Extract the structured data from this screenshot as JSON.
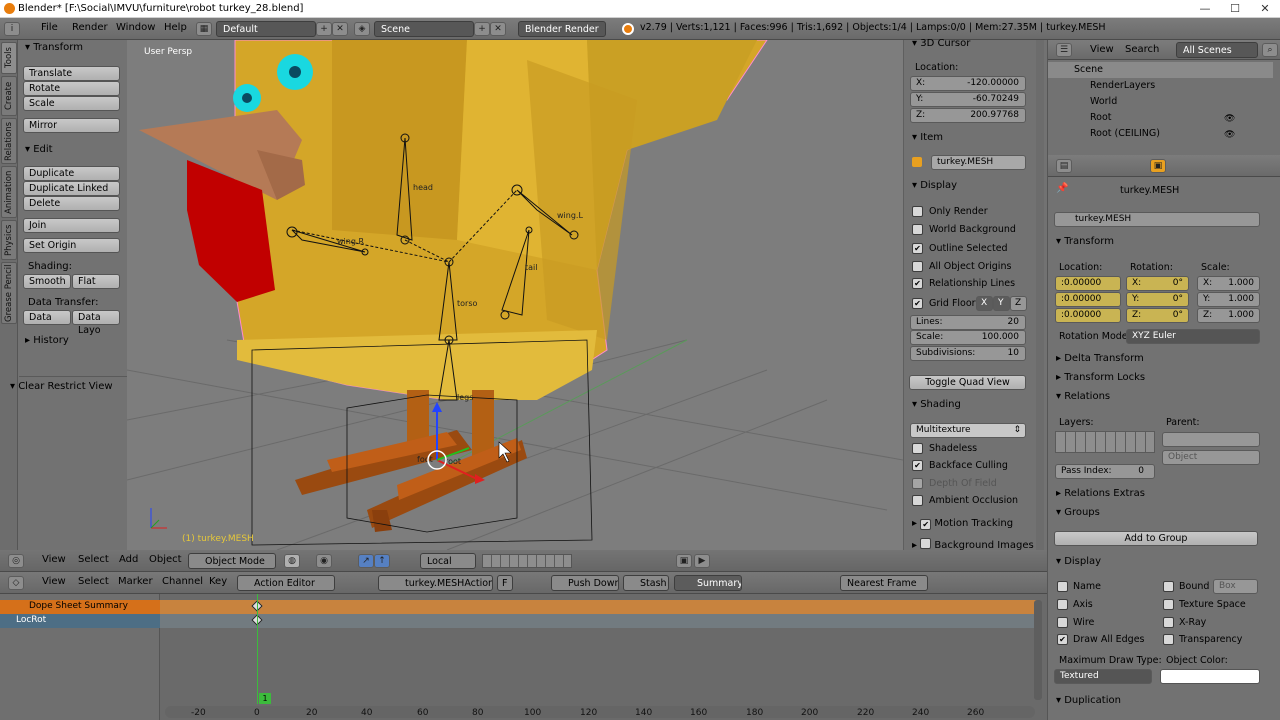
{
  "window": {
    "title": "Blender* [F:\\Social\\IMVU\\furniture\\robot turkey_28.blend]",
    "min": "—",
    "max": "☐",
    "close": "✕"
  },
  "infobar": {
    "menus": [
      "File",
      "Render",
      "Window",
      "Help"
    ],
    "layout": "Default",
    "scene": "Scene",
    "engine": "Blender Render",
    "stats": "v2.79 | Verts:1,121 | Faces:996 | Tris:1,692 | Objects:1/4 | Lamps:0/0 | Mem:27.35M | turkey.MESH"
  },
  "tabs": [
    "Tools",
    "Create",
    "Relations",
    "Animation",
    "Physics",
    "Grease Pencil"
  ],
  "toolshelf": {
    "transform_title": "Transform",
    "translate": "Translate",
    "rotate": "Rotate",
    "scale": "Scale",
    "mirror": "Mirror",
    "edit_title": "Edit",
    "duplicate": "Duplicate",
    "duplicate_linked": "Duplicate Linked",
    "delete": "Delete",
    "join": "Join",
    "set_origin": "Set Origin",
    "shading_label": "Shading:",
    "smooth": "Smooth",
    "flat": "Flat",
    "data_transfer_label": "Data Transfer:",
    "data": "Data",
    "data_layo": "Data Layo",
    "history": "History",
    "clear_restrict": "Clear Restrict View"
  },
  "viewport": {
    "label": "User Persp",
    "object_label": "(1) turkey.MESH",
    "bones": [
      "head",
      "wing.L",
      "wing.R",
      "tail",
      "torso",
      "legs",
      "foot",
      "root"
    ]
  },
  "npanel": {
    "cursor_title": "3D Cursor",
    "location_label": "Location:",
    "x": "X:",
    "x_val": "-120.00000",
    "y": "Y:",
    "y_val": "-60.70249",
    "z": "Z:",
    "z_val": "200.97768",
    "item_title": "Item",
    "item_name": "turkey.MESH",
    "display_title": "Display",
    "only_render": "Only Render",
    "world_bg": "World Background",
    "outline_sel": "Outline Selected",
    "all_origins": "All Object Origins",
    "rel_lines": "Relationship Lines",
    "grid_floor": "Grid Floor",
    "gx": "X",
    "gy": "Y",
    "gz": "Z",
    "lines": "Lines:",
    "lines_val": "20",
    "scale": "Scale:",
    "scale_val": "100.000",
    "subdiv": "Subdivisions:",
    "subdiv_val": "10",
    "toggle_quad": "Toggle Quad View",
    "shading_title": "Shading",
    "multitexture": "Multitexture",
    "shadeless": "Shadeless",
    "backface": "Backface Culling",
    "dof": "Depth Of Field",
    "ao": "Ambient Occlusion",
    "motion_tracking": "Motion Tracking",
    "bg_images": "Background Images"
  },
  "outliner": {
    "view": "View",
    "search": "Search",
    "filter": "All Scenes",
    "items": [
      "Scene",
      "RenderLayers",
      "World",
      "Root",
      "Root (CEILING)"
    ]
  },
  "properties": {
    "breadcrumb": "turkey.MESH",
    "name": "turkey.MESH",
    "transform_title": "Transform",
    "location": "Location:",
    "rotation": "Rotation:",
    "scale": "Scale:",
    "lx": ":0.00000",
    "ly": ":0.00000",
    "lz": ":0.00000",
    "rx": "X:",
    "rx_val": "0°",
    "ry": "Y:",
    "ry_val": "0°",
    "rz": "Z:",
    "rz_val": "0°",
    "sx": "X:",
    "sx_val": "1.000",
    "sy": "Y:",
    "sy_val": "1.000",
    "sz": "Z:",
    "sz_val": "1.000",
    "rot_mode_label": "Rotation Mode:",
    "rot_mode": "XYZ Euler",
    "delta": "Delta Transform",
    "locks": "Transform Locks",
    "relations": "Relations",
    "layers": "Layers:",
    "parent": "Parent:",
    "object_ph": "Object",
    "pass_index": "Pass Index:",
    "pass_val": "0",
    "rel_extras": "Relations Extras",
    "groups": "Groups",
    "add_group": "Add to Group",
    "display": "Display",
    "name_cb": "Name",
    "bound": "Bound",
    "box": "Box",
    "axis": "Axis",
    "texture_space": "Texture Space",
    "wire": "Wire",
    "xray": "X-Ray",
    "draw_all_edges": "Draw All Edges",
    "transparency": "Transparency",
    "max_draw": "Maximum Draw Type:",
    "obj_color": "Object Color:",
    "textured": "Textured",
    "duplication": "Duplication"
  },
  "view3d_header": {
    "menus": [
      "View",
      "Select",
      "Add",
      "Object"
    ],
    "mode": "Object Mode",
    "pivot": "Local"
  },
  "dope_header": {
    "menus": [
      "View",
      "Select",
      "Marker",
      "Channel",
      "Key"
    ],
    "editor": "Action Editor",
    "action": "turkey.MESHAction",
    "f": "F",
    "push_down": "Push Down",
    "stash": "Stash",
    "summary": "Summary",
    "snap": "Nearest Frame"
  },
  "dopesheet": {
    "summary": "Dope Sheet Summary",
    "channel": "LocRot",
    "current_frame": "1",
    "ticks": [
      "-20",
      "0",
      "20",
      "40",
      "60",
      "80",
      "100",
      "120",
      "140",
      "160",
      "180",
      "200",
      "220",
      "240",
      "260"
    ]
  }
}
